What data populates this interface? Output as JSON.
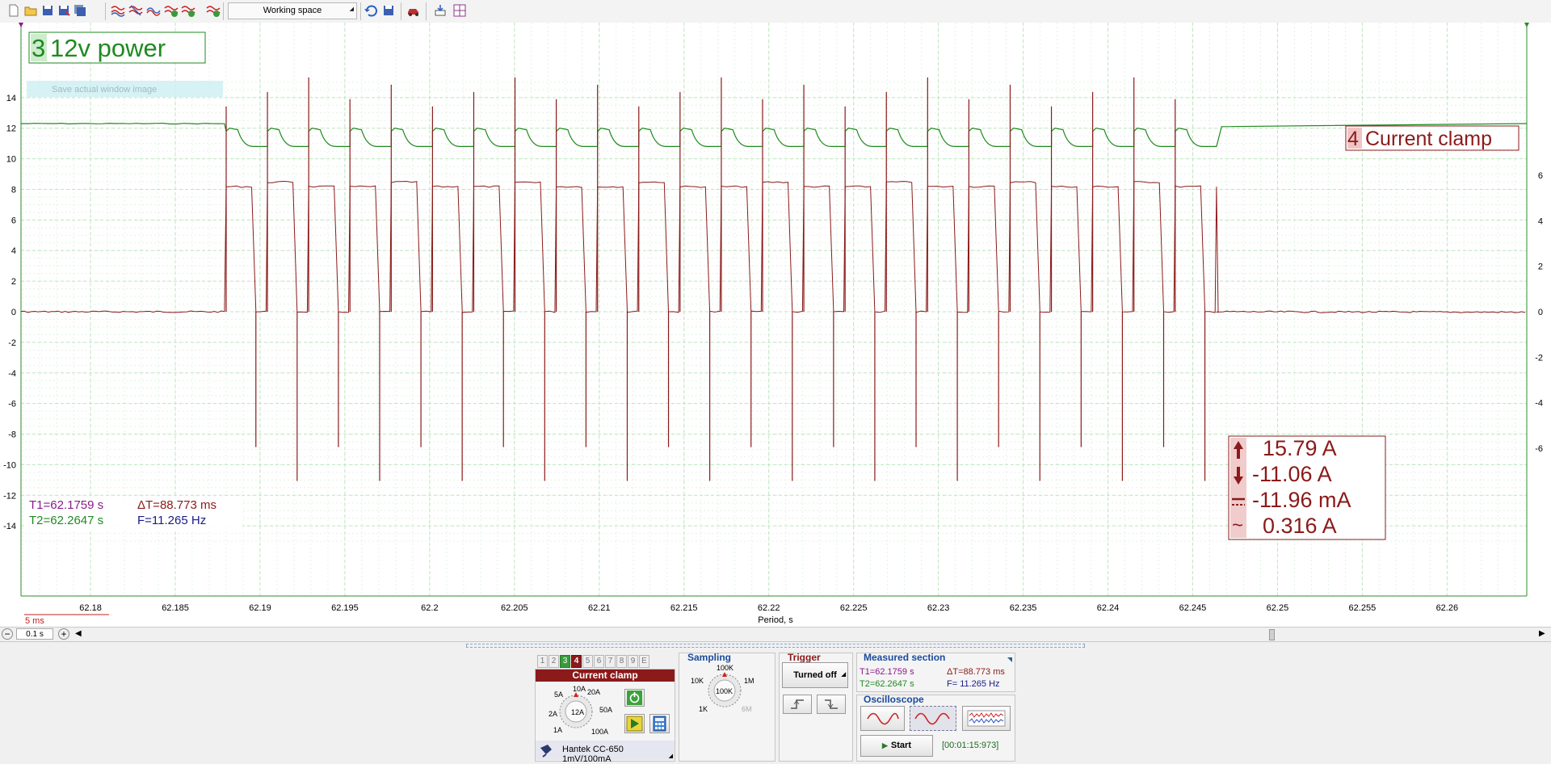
{
  "toolbar": {
    "workspace_label": "Working space"
  },
  "plot": {
    "ch3_tag": "3",
    "ch3_label": "12v power",
    "ch4_tag": "4",
    "ch4_label": "Current clamp",
    "tooltip": "Save actual window image",
    "left_axis_ticks": [
      "14",
      "12",
      "10",
      "8",
      "6",
      "4",
      "2",
      "0",
      "-2",
      "-4",
      "-6",
      "-8",
      "-10",
      "-12",
      "-14"
    ],
    "right_axis_ticks": [
      "6",
      "4",
      "2",
      "0",
      "-2",
      "-4",
      "-6"
    ],
    "x_ticks": [
      "62.18",
      "62.185",
      "62.19",
      "62.195",
      "62.2",
      "62.205",
      "62.21",
      "62.215",
      "62.22",
      "62.225",
      "62.23",
      "62.235",
      "62.24",
      "62.245",
      "62.25",
      "62.255",
      "62.26"
    ],
    "x_label": "Period, s",
    "scale_label": "5 ms",
    "cursor_t1": "T1=62.1759 s",
    "cursor_t2": "T2=62.2647 s",
    "cursor_dt": "ΔT=88.773 ms",
    "cursor_f": "F=11.265 Hz",
    "meas_max": "15.79 A",
    "meas_min": "-11.06 A",
    "meas_avg": "-11.96 mA",
    "meas_rms": "0.316 A",
    "colors": {
      "ch3": "#1f8a1f",
      "ch4": "#8b1a1a",
      "grid": "#bfe5bf",
      "t1": "#8b1a8b",
      "t2": "#1f8a1f"
    }
  },
  "chart_data": {
    "type": "line",
    "x_range": [
      62.1759,
      62.2647
    ],
    "xlabel": "Period, s",
    "series": [
      {
        "name": "12v power",
        "kind": "square_wave",
        "baseline": 12.3,
        "high": 12.0,
        "low": 10.8,
        "burst_start": 62.188,
        "burst_end": 62.2464,
        "after": 12.1
      },
      {
        "name": "Current clamp",
        "kind": "square_wave",
        "baseline": 0.0,
        "high": 5.5,
        "low": 0.0,
        "burst_start": 62.188,
        "burst_end": 62.2464,
        "spike_min": -11.06,
        "spike_max": 15.79
      }
    ],
    "left_ylim": [
      -15,
      15
    ],
    "right_ylim": [
      -8,
      8
    ]
  },
  "hscroll": {
    "zoom_value": "0.1 s"
  },
  "channel_panel": {
    "tabs": [
      "1",
      "2",
      "3",
      "4",
      "5",
      "6",
      "7",
      "8",
      "9",
      "E"
    ],
    "active_name": "Current clamp",
    "dial_labels": [
      "10A",
      "20A",
      "5A",
      "50A",
      "2A",
      "12A",
      "1A",
      "100A"
    ],
    "probe_label": "Hantek CC-650 1mV/100mA"
  },
  "sampling": {
    "title": "Sampling",
    "dial_labels": [
      "100K",
      "10K",
      "1M",
      "100K",
      "1K",
      "6M"
    ]
  },
  "trigger": {
    "title": "Trigger",
    "mode_label": "Turned off"
  },
  "measured": {
    "title": "Measured section",
    "t1": "T1=62.1759 s",
    "dt": "ΔT=88.773 ms",
    "t2": "T2=62.2647 s",
    "f": "F= 11.265 Hz"
  },
  "oscilloscope": {
    "title": "Oscilloscope",
    "start_label": "Start",
    "timer": "[00:01:15:973]"
  }
}
